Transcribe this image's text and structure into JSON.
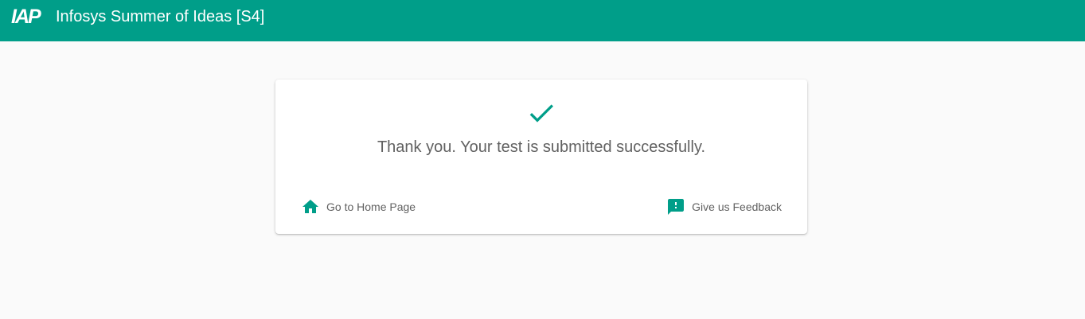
{
  "header": {
    "logo_text": "IAP",
    "title": "Infosys Summer of Ideas [S4]"
  },
  "colors": {
    "brand": "#009e89",
    "text": "#616161",
    "background": "#fafafa"
  },
  "card": {
    "status_icon": "check-icon",
    "message": "Thank you. Your test is submitted successfully.",
    "actions": [
      {
        "icon": "home-icon",
        "label": "Go to Home Page"
      },
      {
        "icon": "feedback-icon",
        "label": "Give us Feedback"
      }
    ]
  }
}
